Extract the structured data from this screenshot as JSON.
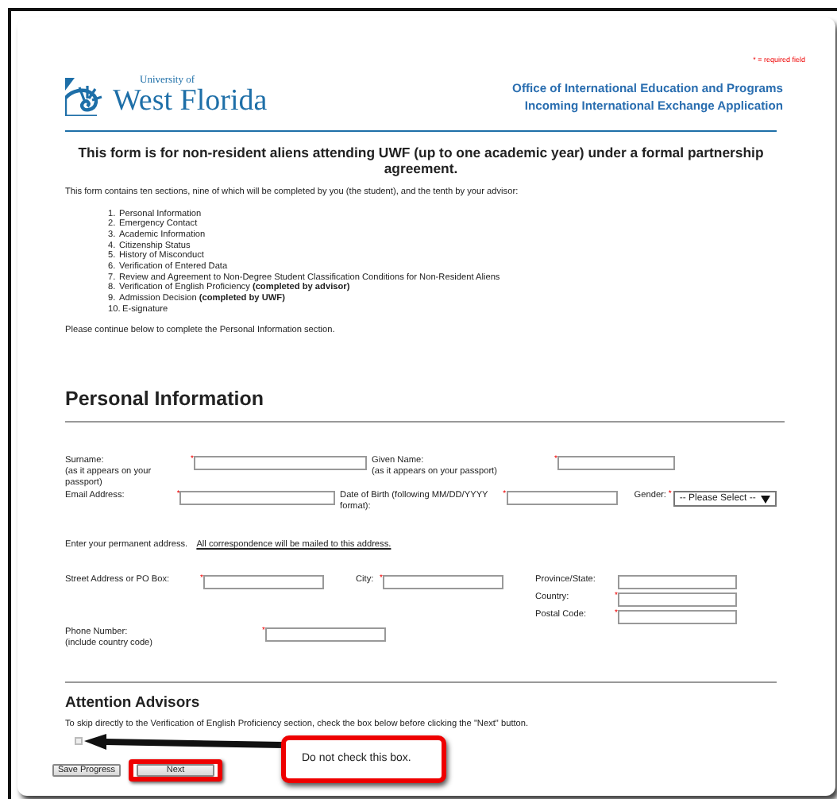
{
  "required_note": "* = required field",
  "required_mark": "*",
  "logo": {
    "line1": "University of",
    "line2": "West Florida"
  },
  "header": [
    "Office of International Education and Programs",
    "Incoming International Exchange Application"
  ],
  "title": "This form is for non-resident aliens attending UWF (up to one academic year) under a formal partnership agreement.",
  "intro": "This form contains ten sections, nine of which will be completed by you (the student), and the tenth by your advisor:",
  "sections": [
    {
      "number": "1.",
      "text": "Personal Information"
    },
    {
      "number": "2.",
      "text": "Emergency Contact"
    },
    {
      "number": "3.",
      "text": "Academic Information"
    },
    {
      "number": "4.",
      "text": "Citizenship Status"
    },
    {
      "number": "5.",
      "text": "History of Misconduct"
    },
    {
      "number": "6.",
      "text": "Verification of Entered Data"
    },
    {
      "number": "7.",
      "text": "Review and Agreement to Non-Degree Student Classification Conditions for Non-Resident Aliens"
    },
    {
      "number": "8.",
      "text": "Verification of English Proficiency **(completed by advisor)**"
    },
    {
      "number": "9.",
      "text": "Admission Decision **(completed by UWF)**"
    },
    {
      "number": "10.",
      "text": "E-signature"
    }
  ],
  "continue_note": "Please continue below to complete the Personal Information section.",
  "personal": {
    "heading": "Personal Information",
    "name_fields": [
      {
        "label": "Surname:",
        "hint": "(as it appears on your passport)",
        "required": true
      },
      {
        "label": "Given Name:",
        "hint": "(as it appears on your passport)",
        "required": true
      }
    ],
    "contact_fields": [
      {
        "label": "Email Address:",
        "required": true
      },
      {
        "label": "Date of Birth (following MM/DD/YYYY format):",
        "required": true
      }
    ],
    "gender": {
      "label": "Gender:",
      "required": true,
      "value": "-- Please Select --"
    },
    "address_note": {
      "text": "Enter your permanent address.",
      "link": "All correspondence will be mailed to this address."
    },
    "street": {
      "label": "Street Address or PO Box:",
      "required": true
    },
    "city": {
      "label": "City:",
      "required": true
    },
    "region_fields": [
      {
        "label": "Province/State:",
        "required": false
      },
      {
        "label": "Country:",
        "required": true
      },
      {
        "label": "Postal Code:",
        "required": true
      }
    ],
    "phone": {
      "label": "Phone Number:",
      "hint": "(include country code)",
      "required": true
    }
  },
  "advisors": {
    "heading": "Attention Advisors",
    "text": "To skip directly to the Verification of English Proficiency section, check the box below before clicking the \"Next\" button.",
    "checkbox": {
      "checked": false
    }
  },
  "buttons": [
    {
      "label": "Save Progress",
      "highlighted": false
    },
    {
      "label": "Next",
      "highlighted": true
    }
  ],
  "callout": {
    "text": "Do not check this box."
  }
}
